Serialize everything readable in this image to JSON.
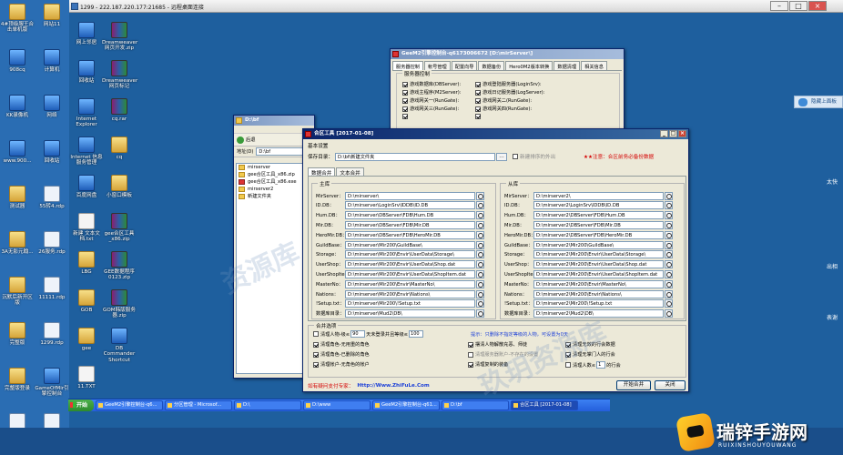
{
  "remote_title": "1299 - 222.187.220.177:21685 - 远程桌面连接",
  "desktop_icons": [
    {
      "label": "4#顶级服王合击单机版",
      "kind": "folder"
    },
    {
      "label": "网站11",
      "kind": "folder"
    },
    {
      "label": "908cq",
      "kind": "blue"
    },
    {
      "label": "计算机",
      "kind": "blue"
    },
    {
      "label": "KK录像机",
      "kind": "blue"
    },
    {
      "label": "网络",
      "kind": "blue"
    },
    {
      "label": "www.900...",
      "kind": "blue"
    },
    {
      "label": "回收站",
      "kind": "blue"
    },
    {
      "label": "测试器",
      "kind": "folder"
    },
    {
      "label": "55转4.rdp",
      "kind": "rdp"
    },
    {
      "label": "3A无影元翰...",
      "kind": "folder"
    },
    {
      "label": "26服务.rdp",
      "kind": "rdp"
    },
    {
      "label": "沉默后新开区版",
      "kind": "folder"
    },
    {
      "label": "11111.rdp",
      "kind": "rdp"
    },
    {
      "label": "完整版",
      "kind": "folder"
    },
    {
      "label": "1299.rdp",
      "kind": "rdp"
    },
    {
      "label": "完整版登录",
      "kind": "folder"
    },
    {
      "label": "GameOfMir引擎控制台",
      "kind": "blue"
    },
    {
      "label": "打开游戏服务.rdp",
      "kind": "rdp"
    },
    {
      "label": "TS-MIR.rdp",
      "kind": "rdp"
    }
  ],
  "desktop_icons_col2": [
    {
      "label": "网上邻居",
      "kind": "blue"
    },
    {
      "label": "Dreamweaver网页开发.zip",
      "kind": "rar"
    },
    {
      "label": "回收站",
      "kind": "blue"
    },
    {
      "label": "Dreamweaver网页标记",
      "kind": "rar"
    },
    {
      "label": "Internet Explorer",
      "kind": "blue"
    },
    {
      "label": "cq.rar",
      "kind": "rar"
    },
    {
      "label": "Internet 信息服务管理",
      "kind": "blue"
    },
    {
      "label": "cq",
      "kind": "folder"
    },
    {
      "label": "百度网盘",
      "kind": "blue"
    },
    {
      "label": "小窗口模板",
      "kind": "folder"
    },
    {
      "label": "新建 文本文档.txt",
      "kind": "doc"
    },
    {
      "label": "gee合区工具_x86.zip",
      "kind": "rar"
    },
    {
      "label": "LBG",
      "kind": "folder"
    },
    {
      "label": "GEE数据程序0123.zip",
      "kind": "rar"
    },
    {
      "label": "GOB",
      "kind": "folder"
    },
    {
      "label": "GOM韩版服务器.zip",
      "kind": "rar"
    },
    {
      "label": "gee",
      "kind": "folder"
    },
    {
      "label": "DB Commander Shortcut",
      "kind": "blue"
    },
    {
      "label": "11.TXT",
      "kind": "doc"
    }
  ],
  "qq_panel": "隐藏上面板",
  "side_texts": [
    "太快",
    "出相",
    "表谢"
  ],
  "engine_window": {
    "title": "GeeM2引擎控制台-q6173006672 [D:\\mirServer\\]",
    "tabs": [
      "服务器控制",
      "帐号管理",
      "配置向导",
      "数据备份",
      "Hero0M2版本转换",
      "数据清理",
      "相关信息"
    ],
    "group_title": "服务器控制",
    "rows": [
      {
        "left": "游戏数据库(DBServer):",
        "right": "游戏登陆服务器(LoginSrv):"
      },
      {
        "left": "游戏主程序(M2Server):",
        "right": "游戏日记服务器(LogServer):"
      },
      {
        "left": "游戏网关一(RunGate):",
        "right": "游戏网关二(RunGate):"
      },
      {
        "left": "游戏网关三(RunGate):",
        "right": "游戏网关四(RunGate):"
      },
      {
        "left": "",
        "right": ""
      }
    ]
  },
  "explorer": {
    "title": "D:\\bf",
    "back_label": "后退",
    "address_label": "地址(D)",
    "address_value": "D:\\bf",
    "items": [
      {
        "name": "mirserver",
        "type": "folder"
      },
      {
        "name": "gee合区工具_x86.zip",
        "type": "zip"
      },
      {
        "name": "gee合区工具_x86.exe",
        "type": "exe"
      },
      {
        "name": "mirserver2",
        "type": "folder"
      },
      {
        "name": "新建文件夹",
        "type": "folder"
      }
    ]
  },
  "main_window": {
    "title": "合区工具 [2017-01-08]",
    "basic_label": "基本设置",
    "save_label": "保存目录：",
    "save_value": "D:\\bf\\新建文件夹",
    "no_sort_label": "新建排序的外出",
    "warning": "★★注意：合区前务必备份数据",
    "tabs": [
      "数据合并",
      "文本合并"
    ],
    "main_group": "主库",
    "sub_group": "从库",
    "field_labels": [
      "MirServer：",
      "ID.DB：",
      "Hum.DB：",
      "Mir.DB：",
      "HeroMir.DB：",
      "GuildBase：",
      "Storage：",
      "UserShop：",
      "UserShopItem：",
      "MasterNo：",
      "Nations：",
      "!Setup.txt：",
      "数据库目录："
    ],
    "main_paths": [
      "D:\\mirserver\\",
      "D:\\mirserver\\LoginSrv\\IDDB\\ID.DB",
      "D:\\mirserver\\DBServer\\FDB\\Hum.DB",
      "D:\\mirserver\\DBServer\\FDB\\Mir.DB",
      "D:\\mirserver\\DBServer\\FDB\\HeroMir.DB",
      "D:\\mirserver\\Mir200\\GuildBase\\",
      "D:\\mirserver\\Mir200\\Envir\\UserData\\Storage\\",
      "D:\\mirserver\\Mir200\\Envir\\UserData\\Shop.dat",
      "D:\\mirserver\\Mir200\\Envir\\UserData\\ShopItem.dat",
      "D:\\mirserver\\Mir200\\Envir\\MasterNo\\",
      "D:\\mirserver\\Mir200\\Envir\\Nations\\",
      "D:\\mirserver\\Mir200\\!Setup.txt",
      "D:\\mirserver\\Mud2\\DB\\"
    ],
    "sub_paths": [
      "D:\\mirserver2\\",
      "D:\\mirserver2\\LoginSrv\\IDDB\\ID.DB",
      "D:\\mirserver2\\DBServer\\FDB\\Hum.DB",
      "D:\\mirserver2\\DBServer\\FDB\\Mir.DB",
      "D:\\mirserver2\\DBServer\\FDB\\HeroMir.DB",
      "D:\\mirserver2\\Mir200\\GuildBase\\",
      "D:\\mirserver2\\Mir200\\Envir\\UserData\\Storage\\",
      "D:\\mirserver2\\Mir200\\Envir\\UserData\\Shop.dat",
      "D:\\mirserver2\\Mir200\\Envir\\UserData\\ShopItem.dat",
      "D:\\mirserver2\\Mir200\\Envir\\MasterNo\\",
      "D:\\mirserver2\\Mir200\\Envir\\Nations\\",
      "D:\\mirserver2\\Mir200\\!Setup.txt",
      "D:\\mirserver2\\Mud2\\DB\\"
    ],
    "options": {
      "title": "合并选项",
      "opt1_a": "清理人物-级≤",
      "opt1_val": "90",
      "opt1_b": "天未登录并且等级≤",
      "opt1_val2": "100",
      "tip": "提示：只删除不指定等级的人物，可设置为0天",
      "opt2": "清理角色-无用重的角色",
      "opt3": "清理角色-已删除的角色",
      "opt4": "清理帐户-无角色的帐户",
      "opt5": "摆清人物解散充恶、师徒",
      "opt6": "清理服务器账户-不存在的设置",
      "opt7": "清理复制的装备",
      "opt8": "清理无效的行会数据",
      "opt9": "清理无掌门人的行会",
      "opt10_a": "清理人数≤",
      "opt10_val": "1",
      "opt10_b": "的行会"
    },
    "support": "如有疑问支付专家：",
    "support_link": "Http://Www.ZhiFuLe.Com",
    "merge_button": "开始合并",
    "close_button": "关闭"
  },
  "taskbar": {
    "start": "开始",
    "items": [
      "GeeM2引擎控制台-q6...",
      "分区管理 - Microsof...",
      "D:\\",
      "D:\\www",
      "GeeM2引擎控制台-q61...",
      "D:\\bf",
      "合区工具 [2017-01-08]"
    ]
  },
  "watermark": {
    "name": "瑞锌手游网",
    "sub": "RUIXINSHOUYOUWANG"
  }
}
